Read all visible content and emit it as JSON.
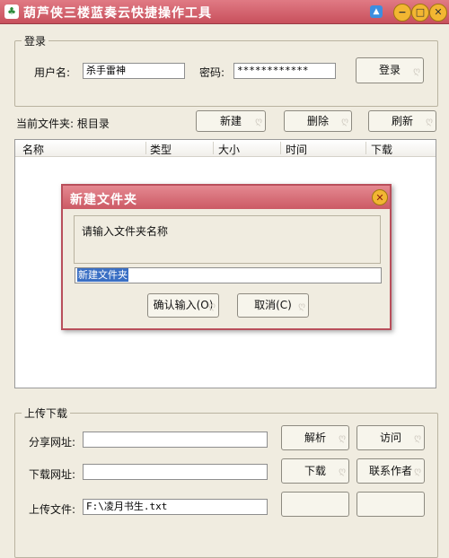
{
  "window": {
    "title": "葫芦侠三楼蓝奏云快捷操作工具",
    "app_icon": "♣",
    "pin_icon": "▲",
    "min_icon": "−",
    "max_icon": "□",
    "close_icon": "✕"
  },
  "login": {
    "legend": "登录",
    "username_label": "用户名:",
    "username_value": "杀手雷神",
    "password_label": "密码:",
    "password_value": "************",
    "login_button": "登录"
  },
  "folder_bar": {
    "current_folder_label": "当前文件夹: 根目录",
    "new_button": "新建",
    "delete_button": "删除",
    "refresh_button": "刷新"
  },
  "file_list": {
    "columns": [
      "名称",
      "类型",
      "大小",
      "时间",
      "下载"
    ]
  },
  "dialog": {
    "title": "新建文件夹",
    "close_icon": "✕",
    "prompt": "请输入文件夹名称",
    "input_value": "新建文件夹",
    "confirm_button": "确认输入(O)",
    "cancel_button": "取消(C)"
  },
  "upload": {
    "legend": "上传下载",
    "share_label": "分享网址:",
    "share_value": "",
    "parse_button": "解析",
    "visit_button": "访问",
    "download_label": "下载网址:",
    "download_value": "",
    "download_button": "下载",
    "contact_button": "联系作者",
    "upload_label": "上传文件:",
    "upload_value": "F:\\凌月书生.txt"
  }
}
